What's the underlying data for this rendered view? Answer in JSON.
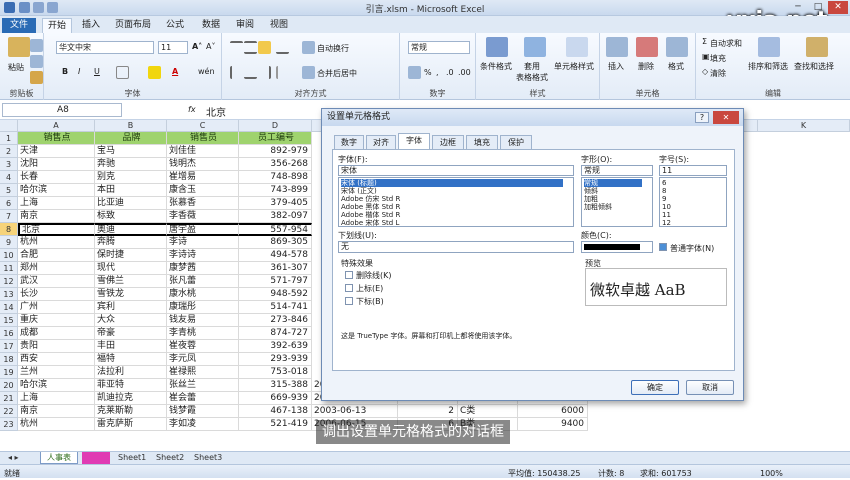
{
  "window": {
    "title": "引言.xlsm - Microsoft Excel",
    "watermark": "vxia.net"
  },
  "ribbon_tabs": [
    "文件",
    "开始",
    "插入",
    "页面布局",
    "公式",
    "数据",
    "审阅",
    "视图"
  ],
  "ribbon": {
    "paste": "粘贴",
    "clipboard": "剪贴板",
    "font_name": "华文中宋",
    "font_size": "11",
    "font_group": "字体",
    "wrap": "自动换行",
    "merge": "合并后居中",
    "align_group": "对齐方式",
    "num_format": "常规",
    "number_group": "数字",
    "cond": "条件格式",
    "table_fmt": "套用\n表格格式",
    "cell_style": "单元格样式",
    "styles_group": "样式",
    "insert": "插入",
    "delete": "删除",
    "format": "格式",
    "cells_group": "单元格",
    "autosum": "自动求和",
    "fill": "填充",
    "clear": "清除",
    "sort": "排序和筛选",
    "find": "查找和选择",
    "edit_group": "编辑"
  },
  "formula_bar": {
    "name_box": "A8",
    "fx": "fx",
    "value": "北京"
  },
  "columns": [
    "A",
    "B",
    "C",
    "D",
    "E",
    "F",
    "G",
    "H",
    "I",
    "J",
    "K"
  ],
  "headers": [
    "销售点",
    "品牌",
    "销售员",
    "员工编号"
  ],
  "rows": [
    [
      "天津",
      "宝马",
      "刘佳佳",
      "892-979"
    ],
    [
      "沈阳",
      "奔驰",
      "钱明杰",
      "356-268"
    ],
    [
      "长春",
      "别克",
      "崔增易",
      "748-898"
    ],
    [
      "哈尔滨",
      "本田",
      "康含玉",
      "743-899"
    ],
    [
      "上海",
      "比亚迪",
      "张慕香",
      "379-405"
    ],
    [
      "南京",
      "标致",
      "李香薇",
      "382-097"
    ],
    [
      "北京",
      "奥迪",
      "唐宇盈",
      "557-954"
    ],
    [
      "杭州",
      "奔腾",
      "李诗",
      "869-305"
    ],
    [
      "合肥",
      "保时捷",
      "李诗诗",
      "494-578"
    ],
    [
      "郑州",
      "现代",
      "康梦茜",
      "361-307"
    ],
    [
      "武汉",
      "雪佛兰",
      "张凡蕾",
      "571-797"
    ],
    [
      "长沙",
      "雪铁龙",
      "康水桃",
      "948-592"
    ],
    [
      "广州",
      "宾利",
      "康瑞彤",
      "514-741"
    ],
    [
      "重庆",
      "大众",
      "钱友易",
      "273-846"
    ],
    [
      "成都",
      "帝豪",
      "李青桃",
      "874-727"
    ],
    [
      "贵阳",
      "丰田",
      "崔夜蓉",
      "392-639"
    ],
    [
      "西安",
      "福特",
      "李元凤",
      "293-939"
    ],
    [
      "兰州",
      "法拉利",
      "崔禄熙",
      "753-018"
    ],
    [
      "哈尔滨",
      "菲亚特",
      "张丝兰",
      "315-388"
    ],
    [
      "上海",
      "凯迪拉克",
      "崔会蕾",
      "669-939"
    ],
    [
      "南京",
      "克莱斯勒",
      "钱梦霞",
      "467-138"
    ],
    [
      "杭州",
      "雷克萨斯",
      "李如凌",
      "521-419"
    ]
  ],
  "extra_rows": [
    [
      "2010-06-19",
      "9",
      "C类",
      "8700"
    ],
    [
      "2003-06-19",
      "9",
      "C类",
      "8000"
    ],
    [
      "2003-06-13",
      "2",
      "C类",
      "6000"
    ],
    [
      "2006-06-15",
      "6",
      "B类",
      "9400"
    ]
  ],
  "sheet_tabs": [
    "人事表",
    "Sheet1",
    "Sheet2",
    "Sheet3"
  ],
  "status": {
    "mode": "就绪",
    "avg": "平均值: 150438.25",
    "count": "计数: 8",
    "sum": "求和: 601753",
    "zoom": "100%"
  },
  "dialog": {
    "title": "设置单元格格式",
    "help": "?",
    "close": "✕",
    "tabs": [
      "数字",
      "对齐",
      "字体",
      "边框",
      "填充",
      "保护"
    ],
    "font_label": "字体(F):",
    "font_value": "宋体",
    "font_list": [
      "宋体 (标题)",
      "宋体 (正文)",
      "Adobe 仿宋 Std R",
      "Adobe 黑体 Std R",
      "Adobe 楷体 Std R",
      "Adobe 宋体 Std L"
    ],
    "style_label": "字形(O):",
    "style_value": "常规",
    "style_list": [
      "常规",
      "倾斜",
      "加粗",
      "加粗倾斜"
    ],
    "size_label": "字号(S):",
    "size_value": "11",
    "size_list": [
      "6",
      "8",
      "9",
      "10",
      "11",
      "12"
    ],
    "underline_label": "下划线(U):",
    "underline_value": "无",
    "color_label": "颜色(C):",
    "normal_font": "普通字体(N)",
    "effects_label": "特殊效果",
    "strike": "删除线(K)",
    "sup": "上标(E)",
    "sub": "下标(B)",
    "preview_label": "预览",
    "preview_text": "微软卓越  AaB",
    "note": "这是 TrueType 字体。屏幕和打印机上都将使用该字体。",
    "ok": "确定",
    "cancel": "取消"
  },
  "caption": "调出设置单元格格式的对话框"
}
